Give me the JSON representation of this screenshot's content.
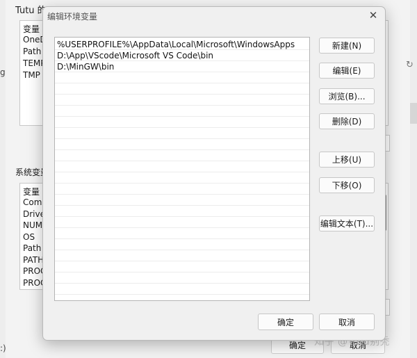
{
  "background": {
    "title": "Tutu 的",
    "side_char_top": "g",
    "side_char_bottom": ":)",
    "user_vars_header": "变量",
    "user_vars": [
      "OneD",
      "Path",
      "TEMP",
      "TMP"
    ],
    "system_vars_label": "系统变量",
    "system_vars_header": "变量",
    "system_vars": [
      "ComS",
      "Drive",
      "NUM",
      "OS",
      "Path",
      "PATH",
      "PROC",
      "PROC"
    ],
    "ok_label": "确定",
    "cancel_label": "取消"
  },
  "watermark": "知乎 @Tutu别秃",
  "dialog": {
    "title": "编辑环境变量",
    "entries": [
      "%USERPROFILE%\\AppData\\Local\\Microsoft\\WindowsApps",
      "D:\\App\\VScode\\Microsoft VS Code\\bin",
      "D:\\MinGW\\bin"
    ],
    "buttons": {
      "new": "新建(N)",
      "edit": "编辑(E)",
      "browse": "浏览(B)...",
      "delete": "删除(D)",
      "move_up": "上移(U)",
      "move_down": "下移(O)",
      "edit_text": "编辑文本(T)...",
      "ok": "确定",
      "cancel": "取消"
    }
  }
}
